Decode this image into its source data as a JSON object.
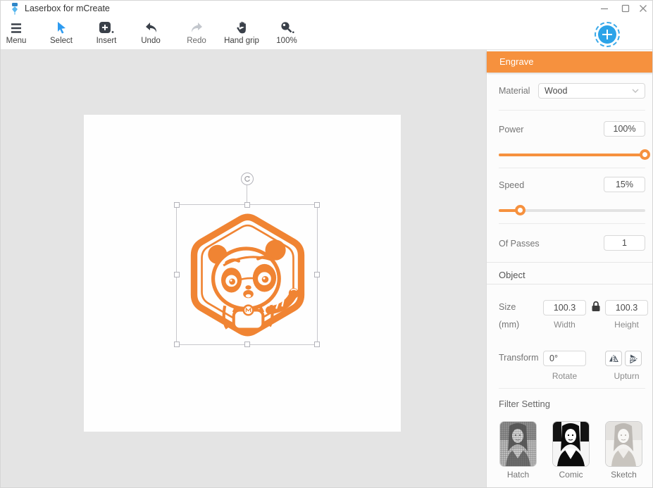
{
  "window": {
    "title": "Laserbox for mCreate"
  },
  "toolbar": {
    "items": [
      {
        "label": "Menu"
      },
      {
        "label": "Select"
      },
      {
        "label": "Insert"
      },
      {
        "label": "Undo"
      },
      {
        "label": "Redo"
      },
      {
        "label": "Hand grip"
      },
      {
        "label": "100%"
      }
    ]
  },
  "panel": {
    "header": "Engrave",
    "material": {
      "label": "Material",
      "value": "Wood"
    },
    "power": {
      "label": "Power",
      "value": "100%",
      "percent": 100
    },
    "speed": {
      "label": "Speed",
      "value": "15%",
      "percent": 15
    },
    "passes": {
      "label": "Of Passes",
      "value": "1"
    },
    "object": {
      "title": "Object",
      "size_label": "Size",
      "size_unit": "(mm)",
      "width_value": "100.3",
      "width_label": "Width",
      "height_value": "100.3",
      "height_label": "Height",
      "transform_label": "Transform",
      "rotate_value": "0°",
      "rotate_label": "Rotate",
      "upturn_label": "Upturn"
    },
    "filter": {
      "title": "Filter Setting",
      "items": [
        {
          "label": "Hatch"
        },
        {
          "label": "Comic"
        },
        {
          "label": "Sketch"
        }
      ]
    }
  },
  "colors": {
    "accent_orange": "#f6913e",
    "artwork_orange": "#f08433",
    "button_blue": "#2ba3e8",
    "select_blue": "#2e9bf0",
    "canvas_gray": "#e4e4e4"
  }
}
